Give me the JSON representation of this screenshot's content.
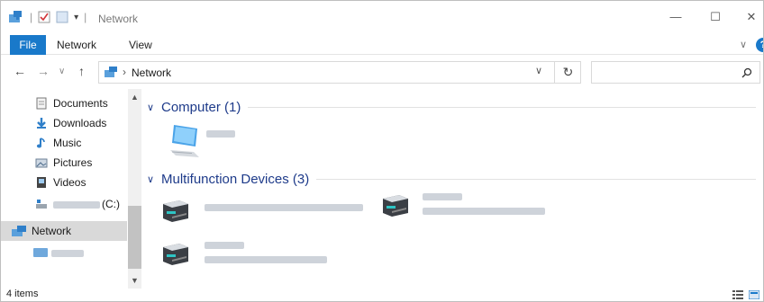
{
  "window": {
    "title": "Network",
    "minimize": "—",
    "maximize": "☐",
    "close": "✕"
  },
  "ribbon": {
    "tabs": [
      {
        "label": "File"
      },
      {
        "label": "Network"
      },
      {
        "label": "View"
      }
    ],
    "help": "?"
  },
  "address": {
    "location": "Network",
    "dropdown": "∨",
    "refresh": "↻",
    "search_placeholder": ""
  },
  "nav": {
    "back": "←",
    "forward": "→",
    "recent": "∨",
    "up": "↑",
    "items": [
      {
        "label": "Documents",
        "icon": "documents-icon"
      },
      {
        "label": "Downloads",
        "icon": "downloads-icon"
      },
      {
        "label": "Music",
        "icon": "music-icon"
      },
      {
        "label": "Pictures",
        "icon": "pictures-icon"
      },
      {
        "label": "Videos",
        "icon": "videos-icon"
      },
      {
        "label": "(C:)",
        "icon": "drive-icon"
      },
      {
        "label": "Network",
        "icon": "network-icon",
        "selected": true
      }
    ]
  },
  "groups": [
    {
      "title": "Computer (1)",
      "chevron": "∨"
    },
    {
      "title": "Multifunction Devices (3)",
      "chevron": "∨"
    }
  ],
  "status": {
    "count": "4 items"
  },
  "colors": {
    "accent": "#1979ca",
    "group_header": "#1e3b8a",
    "selected_bg": "#d9d9d9"
  }
}
